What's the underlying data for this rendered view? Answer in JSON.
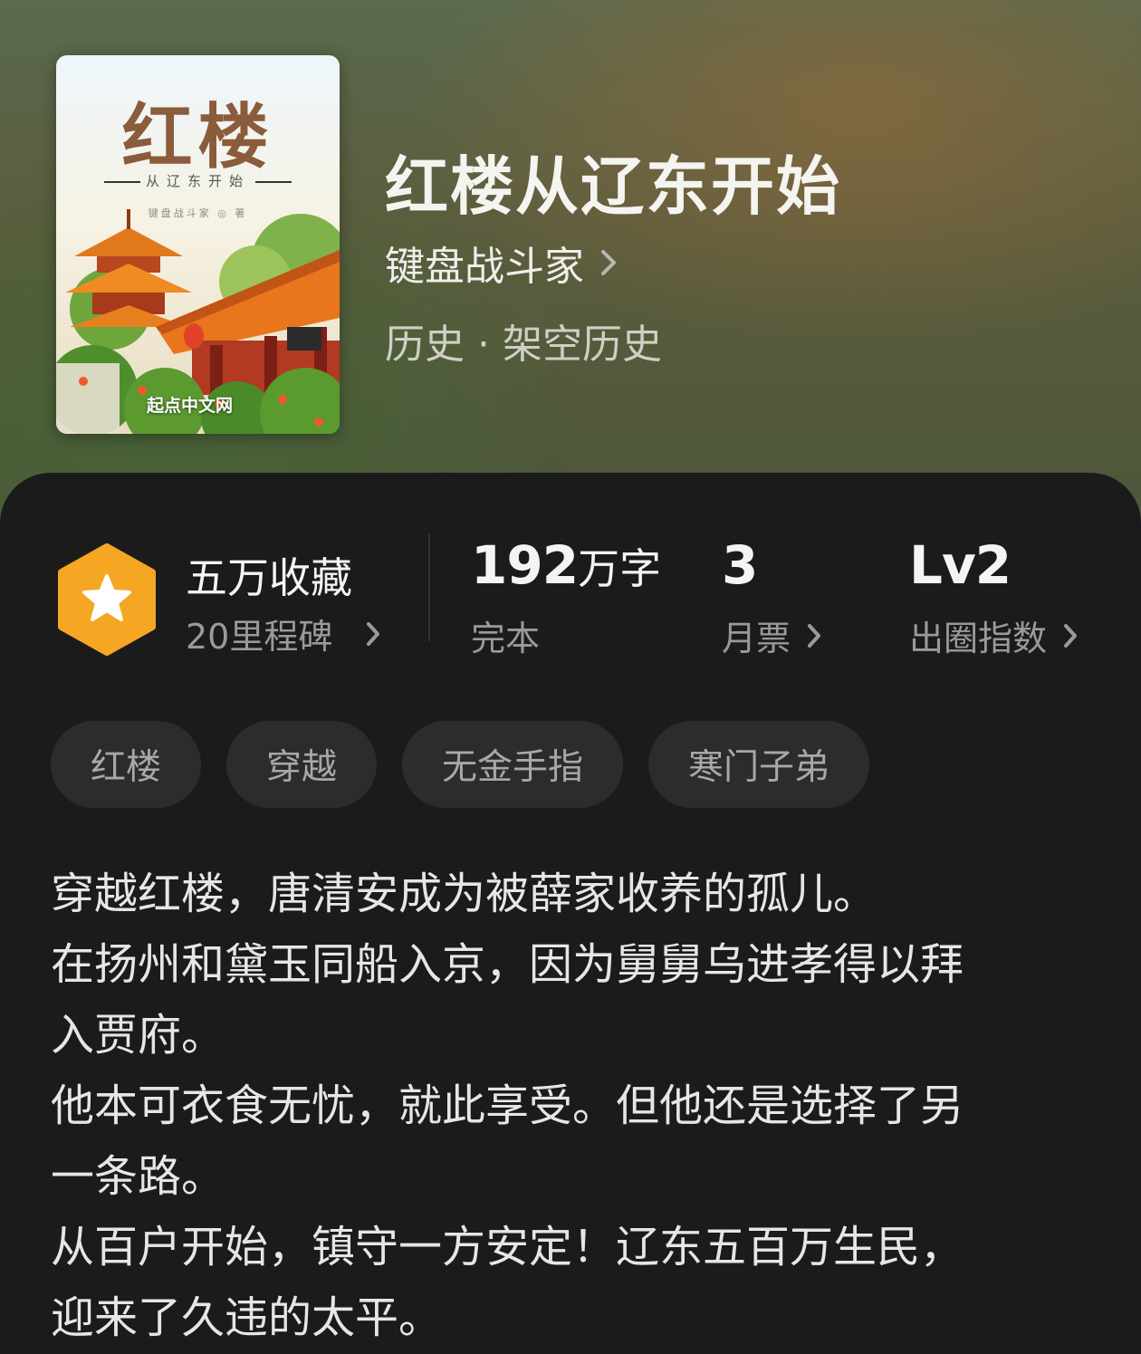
{
  "book": {
    "title": "红楼从辽东开始",
    "author": "键盘战斗家",
    "genre": "历史 · 架空历史"
  },
  "cover": {
    "title": "红楼",
    "subtitle": "从辽东开始",
    "author_line": "键盘战斗家 ◎ 著",
    "brand": "起点中文网"
  },
  "stats": {
    "collection": {
      "title": "五万收藏",
      "subtitle": "20里程碑"
    },
    "words": {
      "number": "192",
      "unit": "万字",
      "label": "完本"
    },
    "monthly_ticket": {
      "value": "3",
      "label": "月票"
    },
    "breakout_index": {
      "value": "Lv2",
      "label": "出圈指数"
    }
  },
  "tags": [
    "红楼",
    "穿越",
    "无金手指",
    "寒门子弟"
  ],
  "description": [
    "穿越红楼，唐清安成为被薛家收养的孤儿。",
    "在扬州和黛玉同船入京，因为舅舅乌进孝得以拜",
    "入贾府。",
    "他本可衣食无忧，就此享受。但他还是选择了另",
    "一条路。",
    "从百户开始，镇守一方安定！辽东五百万生民，",
    "迎来了久违的太平。"
  ],
  "colors": {
    "accent_badge": "#f5a623",
    "panel_bg": "#1b1b1b",
    "tag_bg": "#2c2c2c"
  }
}
